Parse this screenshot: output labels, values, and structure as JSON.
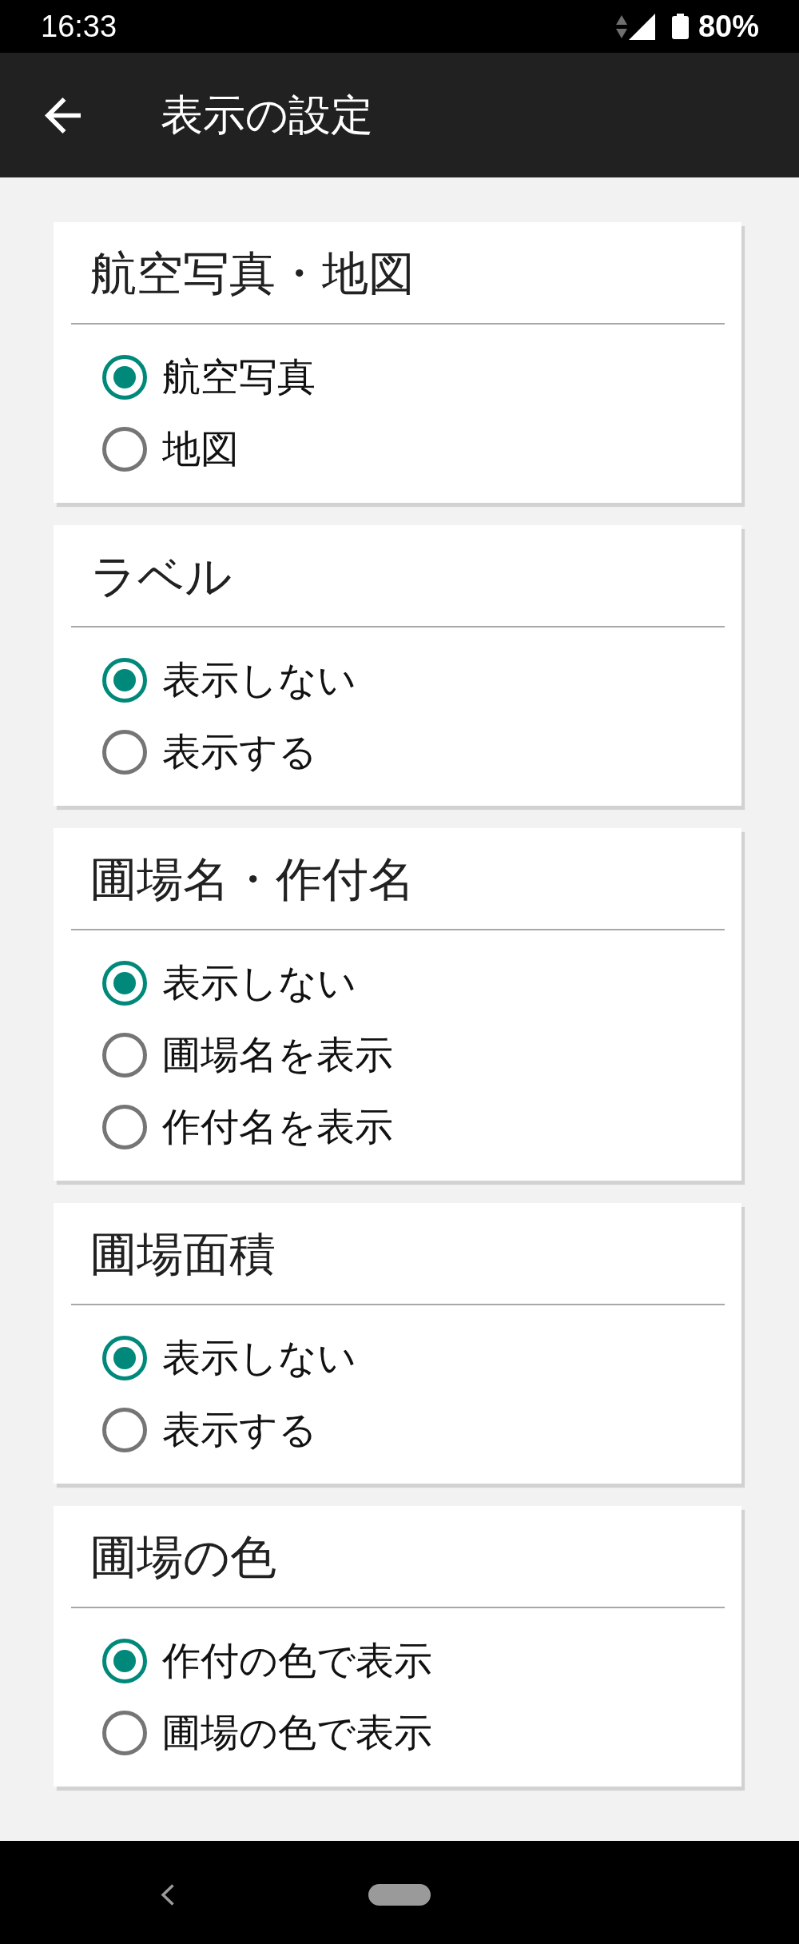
{
  "status_bar": {
    "time": "16:33",
    "battery": "80%"
  },
  "app_bar": {
    "title": "表示の設定"
  },
  "sections": [
    {
      "title": "航空写真・地図",
      "options": [
        {
          "label": "航空写真",
          "selected": true
        },
        {
          "label": "地図",
          "selected": false
        }
      ]
    },
    {
      "title": "ラベル",
      "options": [
        {
          "label": "表示しない",
          "selected": true
        },
        {
          "label": "表示する",
          "selected": false
        }
      ]
    },
    {
      "title": "圃場名・作付名",
      "options": [
        {
          "label": "表示しない",
          "selected": true
        },
        {
          "label": "圃場名を表示",
          "selected": false
        },
        {
          "label": "作付名を表示",
          "selected": false
        }
      ]
    },
    {
      "title": "圃場面積",
      "options": [
        {
          "label": "表示しない",
          "selected": true
        },
        {
          "label": "表示する",
          "selected": false
        }
      ]
    },
    {
      "title": "圃場の色",
      "options": [
        {
          "label": "作付の色で表示",
          "selected": true
        },
        {
          "label": "圃場の色で表示",
          "selected": false
        }
      ]
    }
  ]
}
